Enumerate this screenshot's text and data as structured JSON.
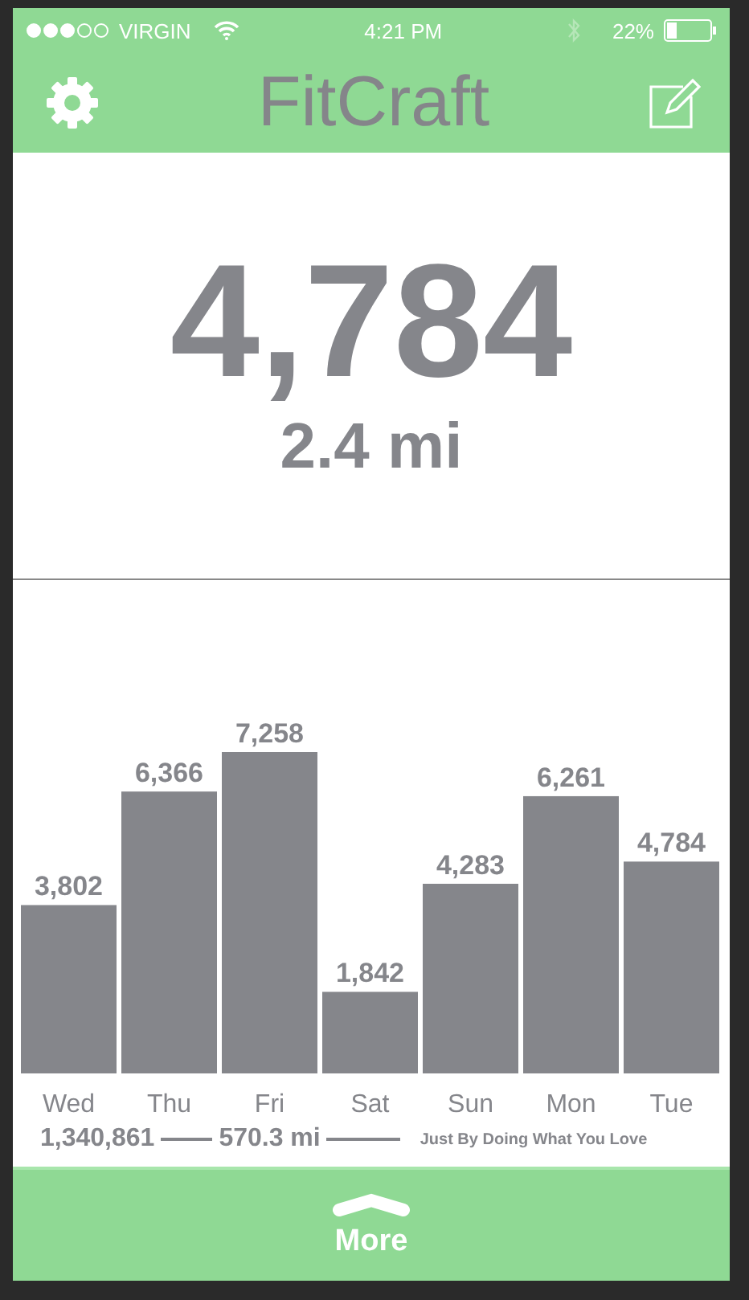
{
  "status_bar": {
    "carrier": "VIRGIN",
    "time": "4:21 PM",
    "battery": "22%"
  },
  "header": {
    "title": "FitCraft"
  },
  "today": {
    "steps": "4,784",
    "distance": "2.4 mi"
  },
  "history": {
    "chart_data": {
      "type": "bar",
      "categories": [
        "Wed",
        "Thu",
        "Fri",
        "Sat",
        "Sun",
        "Mon",
        "Tue"
      ],
      "values": [
        3802,
        6366,
        7258,
        1842,
        4283,
        6261,
        4784
      ],
      "value_labels": [
        "3,802",
        "6,366",
        "7,258",
        "1,842",
        "4,283",
        "6,261",
        "4,784"
      ]
    }
  },
  "totals": {
    "steps": "1,340,861",
    "distance": "570.3 mi",
    "tagline": "Just By Doing What You Love"
  },
  "footer": {
    "label": "More"
  }
}
